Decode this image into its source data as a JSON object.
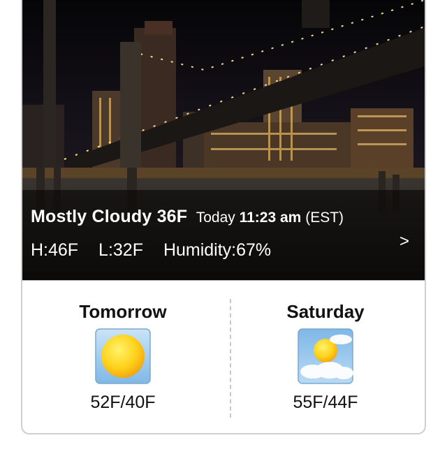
{
  "current": {
    "condition": "Mostly Cloudy 36F",
    "today_label": "Today",
    "time": "11:23 am",
    "timezone": "(EST)",
    "high": "H:46F",
    "low": "L:32F",
    "humidity": "Humidity:67%",
    "more_icon": ">"
  },
  "forecast": [
    {
      "day": "Tomorrow",
      "icon": "sunny-icon",
      "temps": "52F/40F"
    },
    {
      "day": "Saturday",
      "icon": "partly-cloudy-icon",
      "temps": "55F/44F"
    }
  ],
  "colors": {
    "sun": "#f6b812",
    "sky": "#8fc3ea",
    "card_border": "#cfcfcf"
  }
}
